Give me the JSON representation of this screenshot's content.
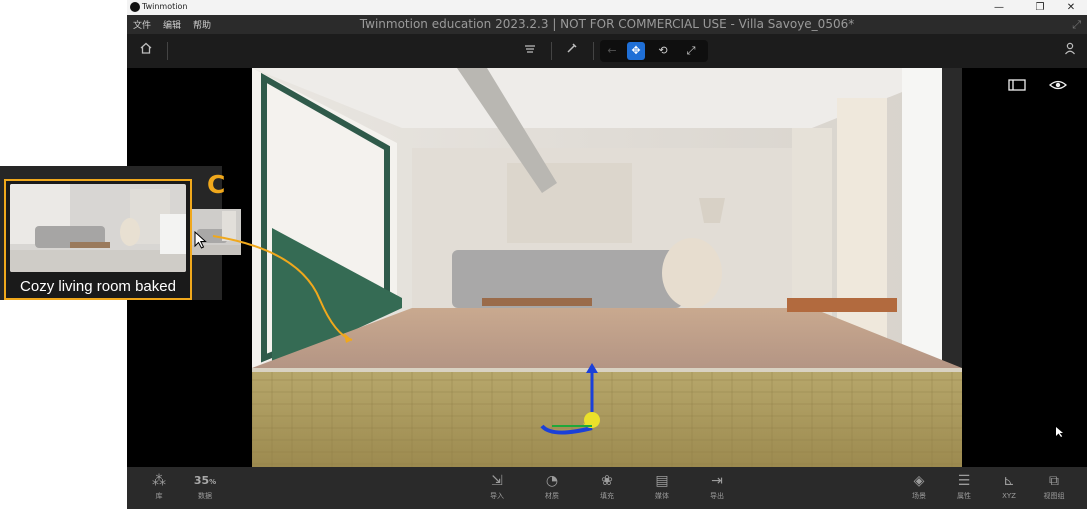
{
  "titlebar": {
    "app_name": "Twinmotion",
    "minimize": "—",
    "restore": "❐",
    "close": "✕"
  },
  "menubar": {
    "items": [
      "文件",
      "编辑",
      "帮助"
    ],
    "doc_title": "Twinmotion education 2023.2.3 | NOT FOR COMMERCIAL USE - Villa Savoye_0506*"
  },
  "bottombar": {
    "library": "库",
    "fps_value": "35",
    "fps_unit": "%",
    "fps_label": "数据",
    "import": "导入",
    "material": "材质",
    "fill": "填充",
    "media": "媒体",
    "export": "导出",
    "scene": "场景",
    "properties": "属性",
    "xyz": "XYZ",
    "view_group": "视图组"
  },
  "overlay": {
    "step_letter": "C",
    "thumbnail_label": "Cozy living room baked"
  },
  "colors": {
    "accent": "#f0a81c",
    "nav_active": "#1f6fd6"
  }
}
